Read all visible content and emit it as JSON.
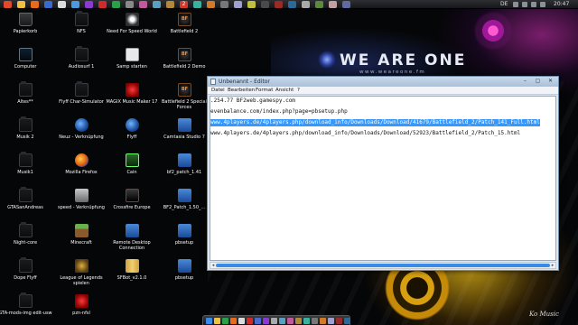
{
  "colors": {
    "selection": "#3399ff",
    "scrollbar_thumb": "#3a8ae8",
    "titlebar": "#b8cce2",
    "wallpaper_gold": "#d8a010",
    "wallpaper_magenta": "#a0189a"
  },
  "wallpaper": {
    "brand": "WE ARE ONE",
    "brand_url": "www.weareone.fm",
    "signature": "Ko Music"
  },
  "top_bar": {
    "language": "DE",
    "clock": "20:47",
    "launcher_icons": [
      "chrome-icon",
      "folder-icon",
      "firefox-icon",
      "steam-icon",
      "notepad-icon",
      "explorer-icon",
      "media-icon",
      "game-icon",
      "app-icon",
      "app-icon",
      "app-icon",
      "app-icon",
      "app-icon",
      "app-icon",
      "app-icon",
      "app-icon",
      "app-icon",
      "app-icon",
      "app-icon",
      "app-icon",
      "app-icon",
      "app-icon",
      "app-icon",
      "app-icon",
      "app-icon",
      "app-icon"
    ],
    "badge": "2"
  },
  "desktop_icons": [
    {
      "label": "Papierkorb",
      "icon": "trash-icon"
    },
    {
      "label": "NFS",
      "icon": "folder-icon"
    },
    {
      "label": "Need For Speed World",
      "icon": "nfs-icon"
    },
    {
      "label": "Battlefield 2",
      "icon": "battlefield-icon"
    },
    {
      "label": "Computer",
      "icon": "computer-icon"
    },
    {
      "label": "Audiosurf 1",
      "icon": "folder-icon"
    },
    {
      "label": "Samp starten",
      "icon": "samp-icon"
    },
    {
      "label": "Battlefield 2 Demo",
      "icon": "battlefield-icon"
    },
    {
      "label": "Altes**",
      "icon": "folder-icon"
    },
    {
      "label": "Flyff Char-Simulator",
      "icon": "folder-icon"
    },
    {
      "label": "MAGIX Music Maker 17",
      "icon": "magix-icon"
    },
    {
      "label": "Battlefield 2 Special Forces",
      "icon": "battlefield-icon"
    },
    {
      "label": "Musik 2",
      "icon": "folder-icon"
    },
    {
      "label": "Neuz - Verknüpfung",
      "icon": "globe-icon"
    },
    {
      "label": "Flyff",
      "icon": "flyff-icon"
    },
    {
      "label": "Camtasia Studio 7",
      "icon": "camtasia-icon"
    },
    {
      "label": "Musik1",
      "icon": "folder-icon"
    },
    {
      "label": "Mozilla Firefox",
      "icon": "firefox-icon"
    },
    {
      "label": "Cain",
      "icon": "cain-icon"
    },
    {
      "label": "bf2_patch_1.41",
      "icon": "installer-icon"
    },
    {
      "label": "GTASanAndreas",
      "icon": "folder-icon"
    },
    {
      "label": "speed - Verknüpfung",
      "icon": "speed-icon"
    },
    {
      "label": "Crossfire Europe",
      "icon": "crossfire-icon"
    },
    {
      "label": "BF2_Patch_1.50_...",
      "icon": "installer-icon"
    },
    {
      "label": "Night-core",
      "icon": "folder-icon"
    },
    {
      "label": "Minecraft",
      "icon": "minecraft-icon"
    },
    {
      "label": "Remote Desktop Connection",
      "icon": "remote-desktop-icon"
    },
    {
      "label": "pbsetup",
      "icon": "installer-icon"
    },
    {
      "label": "Dope Flyff",
      "icon": "folder-icon"
    },
    {
      "label": "League of Legends spielen",
      "icon": "league-icon"
    },
    {
      "label": "SFBot_v2.1.0",
      "icon": "archive-icon"
    },
    {
      "label": "pbsetup",
      "icon": "installer-icon"
    },
    {
      "label": "GTA-mods-img edit-usw",
      "icon": "folder-icon"
    },
    {
      "label": "pzn-nfsl",
      "icon": "zip-icon"
    }
  ],
  "editor": {
    "title": "Unbenannt - Editor",
    "controls": {
      "minimize": "–",
      "maximize": "▢",
      "close": "✕"
    },
    "menu": [
      "Datei",
      "Bearbeiten",
      "Format",
      "Ansicht",
      "?"
    ],
    "lines": [
      {
        "text": ".254.77 BF2web.gamespy.com",
        "selected": false
      },
      {
        "text": "evenbalance.com/index.php?page=pbsetup.php",
        "selected": false
      },
      {
        "text": "www.4players.de/4players.php/download_info/Downloads/Download/41679/Battlefield_2/Patch_141_Full.html",
        "selected": true
      },
      {
        "text": "www.4players.de/4players.php/download_info/Downloads/Download/52923/Battlefield_2/Patch_15.html",
        "selected": false
      }
    ],
    "scroll_left": "◂",
    "scroll_right": "▸"
  },
  "taskbar": {
    "icons": [
      "windows-icon",
      "explorer-icon",
      "chrome-icon",
      "firefox-icon",
      "notepad-icon",
      "media-icon",
      "steam-icon",
      "game-icon",
      "app-icon",
      "app-icon",
      "app-icon",
      "app-icon",
      "app-icon",
      "app-icon",
      "app-icon",
      "app-icon",
      "app-icon",
      "app-icon"
    ]
  }
}
